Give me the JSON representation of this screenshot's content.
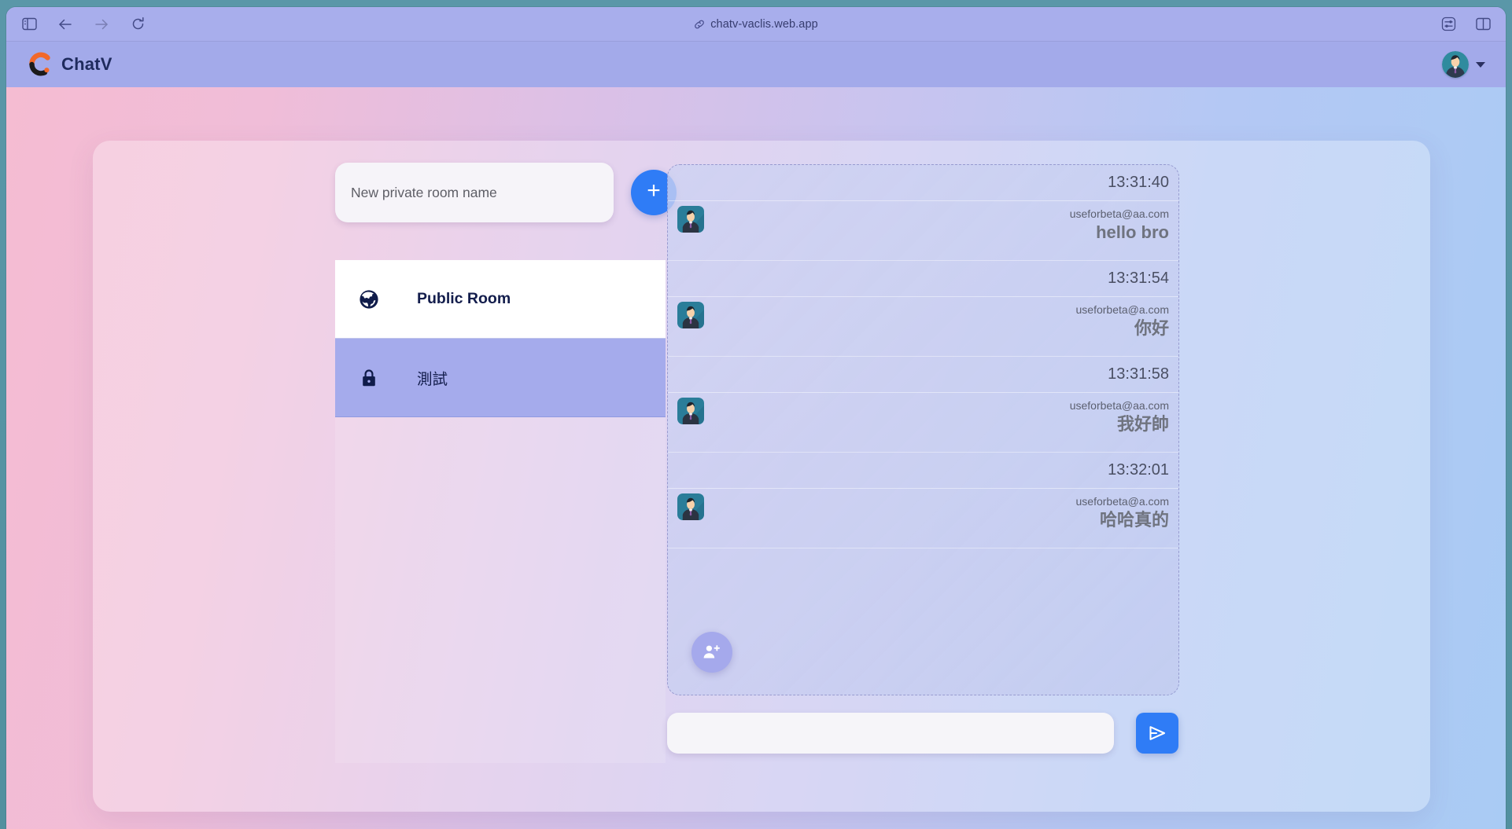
{
  "browser": {
    "url": "chatv-vaclis.web.app",
    "icons": {
      "sidebar_toggle": "sidebar-toggle-icon",
      "back": "back-arrow-icon",
      "forward": "forward-arrow-icon",
      "reload": "reload-icon",
      "link": "link-icon",
      "extensions": "extensions-icon",
      "tab_overview": "tab-overview-icon"
    }
  },
  "header": {
    "brand_name": "ChatV",
    "logo_icon": "chatv-logo-icon",
    "avatar_icon": "user-avatar",
    "caret_icon": "chevron-down-icon"
  },
  "rooms_panel": {
    "new_room_placeholder": "New private room name",
    "new_room_value": "",
    "add_button_label": "+",
    "rooms": [
      {
        "name": "Public Room",
        "icon": "globe-icon",
        "type": "public",
        "selected": false
      },
      {
        "name": "測試",
        "icon": "lock-icon",
        "type": "private",
        "selected": true
      }
    ]
  },
  "chat_panel": {
    "messages": [
      {
        "time": "13:31:40",
        "sender": "useforbeta@aa.com",
        "text": "hello bro"
      },
      {
        "time": "13:31:54",
        "sender": "useforbeta@a.com",
        "text": "你好"
      },
      {
        "time": "13:31:58",
        "sender": "useforbeta@aa.com",
        "text": "我好帥"
      },
      {
        "time": "13:32:01",
        "sender": "useforbeta@a.com",
        "text": "哈哈真的"
      }
    ],
    "add_member_icon": "add-person-icon",
    "composer": {
      "placeholder": "",
      "value": "",
      "send_icon": "send-icon"
    }
  },
  "colors": {
    "accent_blue": "#2f7cf6",
    "header_purple": "#a3aaea",
    "selected_room": "#a5abec",
    "logo_orange": "#f2682a",
    "logo_dark": "#1a1a1a"
  }
}
